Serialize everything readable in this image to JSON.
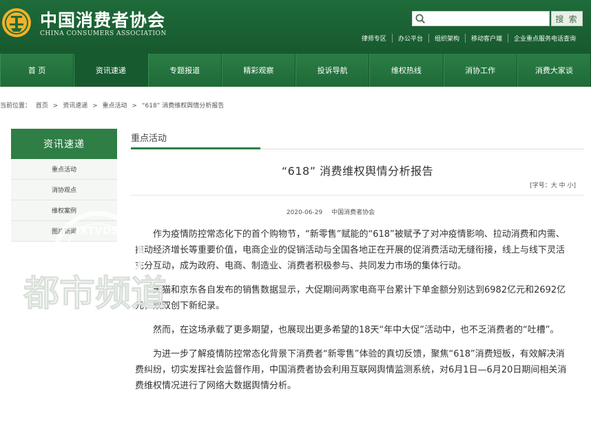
{
  "header": {
    "logo_cn": "中国消费者协会",
    "logo_en": "CHINA CONSUMERS ASSOCIATION",
    "search": {
      "placeholder": "",
      "value": "",
      "button_label": "搜 索"
    },
    "top_links": [
      "律师专区",
      "办公平台",
      "组织架构",
      "移动客户端",
      "企业重点服务电话查询"
    ]
  },
  "nav": {
    "items": [
      "首 页",
      "资讯速递",
      "专题报道",
      "精彩观察",
      "投诉导航",
      "维权热线",
      "消协工作",
      "消费大家谈"
    ],
    "active_index": 1
  },
  "breadcrumb": {
    "label": "当前位置：",
    "items": [
      "首页",
      "资讯速递",
      "重点活动",
      "“618” 消费维权舆情分析报告"
    ],
    "separator": ">"
  },
  "sidebar": {
    "title": "资讯速递",
    "items": [
      "重点活动",
      "消协观点",
      "维权案例",
      "图片新闻"
    ]
  },
  "main": {
    "section_title": "重点活动",
    "article": {
      "title": "“618” 消费维权舆情分析报告",
      "font_size_control": "[字号：大 中 小]",
      "date": "2020-06-29",
      "source": "中国消费者协会",
      "paragraphs": [
        "作为疫情防控常态化下的首个购物节，“新零售”赋能的“618”被赋予了对冲疫情影响、拉动消费和内需、推动经济增长等重要价值，电商企业的促销活动与全国各地正在开展的促消费活动无缝衔接，线上与线下灵活充分互动，成为政府、电商、制造业、消费者积极参与、共同发力市场的集体行动。",
        "天猫和京东各自发布的销售数据显示，大促期间两家电商平台累计下单金额分别达到6982亿元和2692亿元，双双创下新纪录。",
        "然而，在这场承载了更多期望，也展现出更多希望的18天“年中大促”活动中，也不乏消费者的“吐槽”。",
        "为进一步了解疫情防控常态化背景下消费者“新零售”体验的真切反馈，聚焦“618”消费短板，有效解决消费纠纷，切实发挥社会监督作用，中国消费者协会利用互联网舆情监测系统，对6月1日—6月20日期间相关消费维权情况进行了网络大数据舆情分析。"
      ]
    }
  },
  "watermark": {
    "text": "都市频道",
    "ring_text": "IXTVDS"
  },
  "colors": {
    "header_green": "#1f6b3a",
    "nav_green": "#2a7d44",
    "accent_green": "#2f7e45",
    "logo_gold": "#f0b22a"
  },
  "icons": {
    "logo": "consumer-association-emblem-icon",
    "search": "search-icon"
  }
}
